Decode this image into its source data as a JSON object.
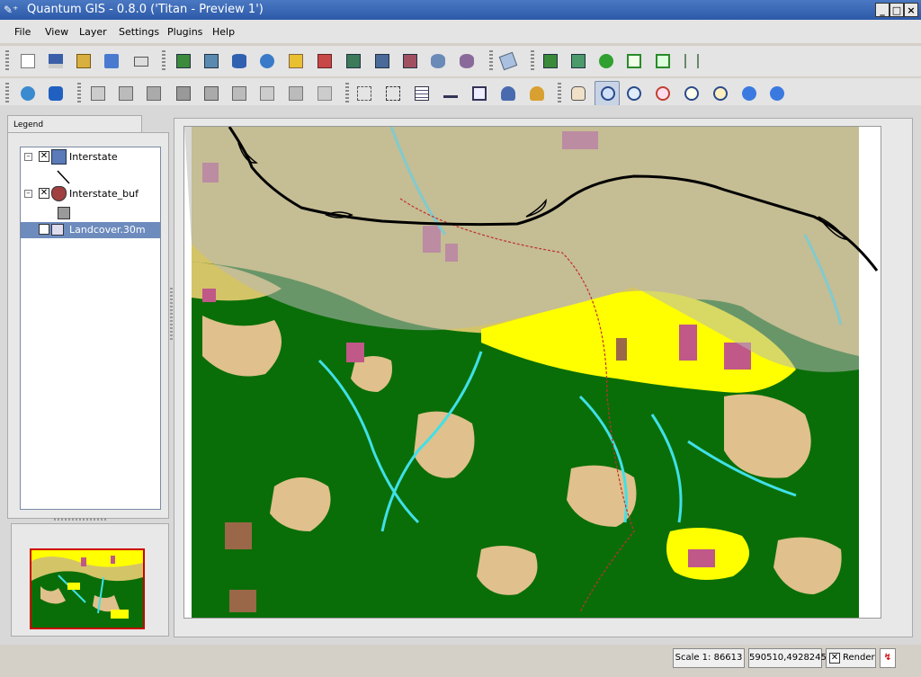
{
  "window": {
    "title": "Quantum GIS - 0.8.0 ('Titan - Preview 1')",
    "controls": [
      "_",
      "□",
      "×"
    ]
  },
  "menubar": [
    "File",
    "View",
    "Layer",
    "Settings",
    "Plugins",
    "Help"
  ],
  "legend": {
    "tab_label": "Legend",
    "layers": [
      {
        "name": "Interstate",
        "type": "line",
        "visible": true,
        "expanded": true
      },
      {
        "name": "Interstate_buf",
        "type": "polygon",
        "visible": true,
        "expanded": true,
        "symbol_color": "#9a9a9a"
      },
      {
        "name": "Landcover.30m",
        "type": "raster",
        "visible": true,
        "selected": true
      }
    ]
  },
  "map": {
    "colors": {
      "forest": "#0a6e08",
      "shrub": "#e0c08c",
      "grass": "#d4c468",
      "developed": "#ffff00",
      "urban": "#c05888",
      "water": "#40e0e8",
      "bare": "#9a6848",
      "buffer": "#b8b8b8",
      "road": "#000000"
    }
  },
  "statusbar": {
    "scale": "Scale 1: 86613",
    "coords": "590510,4928245",
    "render_label": "Render",
    "render_checked": true
  }
}
